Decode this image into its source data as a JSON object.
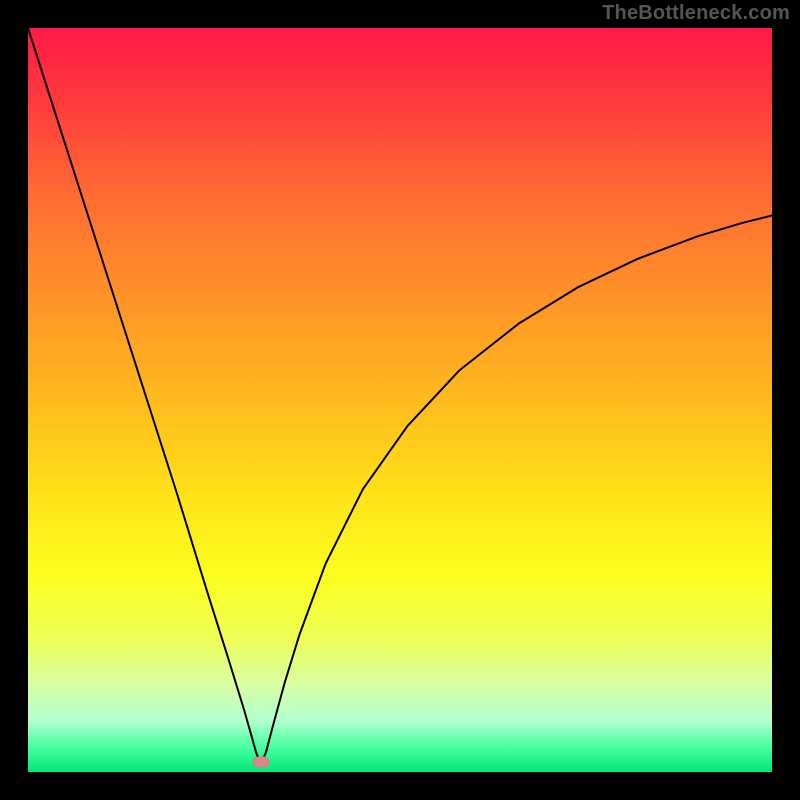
{
  "watermark": "TheBottleneck.com",
  "colors": {
    "black": "#000000",
    "marker": "#d68a8a",
    "curve": "#000000"
  },
  "gradient_stops": [
    {
      "offset": 0.0,
      "color": "#ff1a47"
    },
    {
      "offset": 0.1,
      "color": "#ff3a3e"
    },
    {
      "offset": 0.22,
      "color": "#ff6a33"
    },
    {
      "offset": 0.36,
      "color": "#ff9228"
    },
    {
      "offset": 0.5,
      "color": "#ffba1e"
    },
    {
      "offset": 0.62,
      "color": "#ffe018"
    },
    {
      "offset": 0.74,
      "color": "#fbff20"
    },
    {
      "offset": 0.82,
      "color": "#eeff55"
    },
    {
      "offset": 0.88,
      "color": "#daffa0"
    },
    {
      "offset": 0.93,
      "color": "#b3ffcf"
    },
    {
      "offset": 0.965,
      "color": "#4dffa3"
    },
    {
      "offset": 1.0,
      "color": "#00e876"
    }
  ],
  "chart_data": {
    "type": "line",
    "title": "",
    "xlabel": "",
    "ylabel": "",
    "xlim": [
      0,
      1
    ],
    "ylim": [
      0,
      1
    ],
    "grid": false,
    "legend": false,
    "marker": {
      "x": 0.313,
      "y": 0.013
    },
    "series": [
      {
        "name": "curve",
        "x": [
          0.0,
          0.04,
          0.08,
          0.12,
          0.16,
          0.2,
          0.24,
          0.27,
          0.29,
          0.3,
          0.307,
          0.313,
          0.32,
          0.33,
          0.345,
          0.365,
          0.4,
          0.45,
          0.51,
          0.58,
          0.66,
          0.74,
          0.82,
          0.9,
          0.96,
          1.0
        ],
        "y": [
          1.0,
          0.875,
          0.75,
          0.625,
          0.5,
          0.375,
          0.245,
          0.15,
          0.085,
          0.05,
          0.025,
          0.01,
          0.027,
          0.065,
          0.12,
          0.185,
          0.28,
          0.38,
          0.465,
          0.54,
          0.603,
          0.652,
          0.69,
          0.72,
          0.738,
          0.748
        ]
      }
    ],
    "annotations": []
  }
}
